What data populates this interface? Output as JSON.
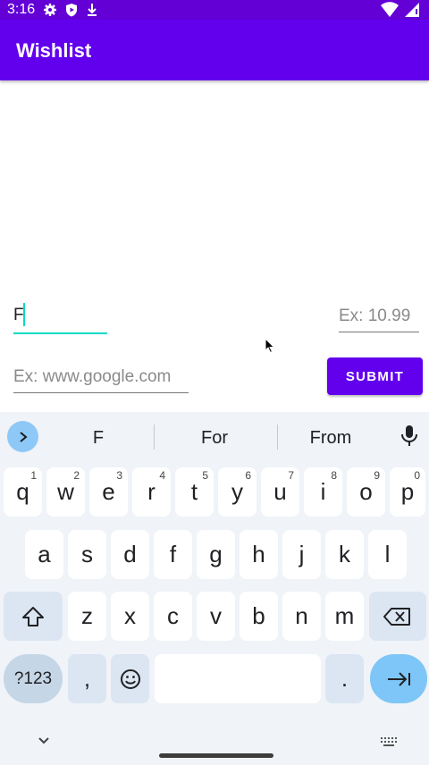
{
  "status_bar": {
    "time": "3:16",
    "icons": [
      "gear-icon",
      "play-protect-icon",
      "download-icon"
    ],
    "right_icons": [
      "wifi-icon",
      "battery-icon"
    ]
  },
  "app_bar": {
    "title": "Wishlist"
  },
  "form": {
    "name_value": "F",
    "price_placeholder": "Ex: 10.99",
    "url_placeholder": "Ex: www.google.com",
    "submit_label": "SUBMIT"
  },
  "keyboard": {
    "suggestions": [
      "F",
      "For",
      "From"
    ],
    "row1": [
      {
        "key": "q",
        "hint": "1"
      },
      {
        "key": "w",
        "hint": "2"
      },
      {
        "key": "e",
        "hint": "3"
      },
      {
        "key": "r",
        "hint": "4"
      },
      {
        "key": "t",
        "hint": "5"
      },
      {
        "key": "y",
        "hint": "6"
      },
      {
        "key": "u",
        "hint": "7"
      },
      {
        "key": "i",
        "hint": "8"
      },
      {
        "key": "o",
        "hint": "9"
      },
      {
        "key": "p",
        "hint": "0"
      }
    ],
    "row2": [
      "a",
      "s",
      "d",
      "f",
      "g",
      "h",
      "j",
      "k",
      "l"
    ],
    "row3": [
      "z",
      "x",
      "c",
      "v",
      "b",
      "n",
      "m"
    ],
    "symbols_label": "?123",
    "comma_label": ",",
    "period_label": "."
  },
  "colors": {
    "primary": "#6200ee",
    "status_bar": "#6200d6",
    "accent": "#03dac5",
    "keyboard_bg": "#f0f3f8"
  }
}
